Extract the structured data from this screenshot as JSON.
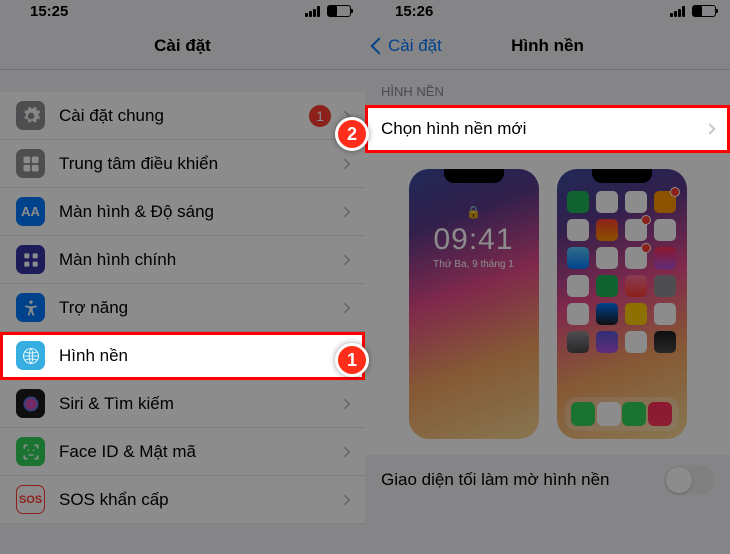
{
  "markers": {
    "one": "1",
    "two": "2"
  },
  "left": {
    "status": {
      "time": "15:25"
    },
    "title": "Cài đặt",
    "rows": {
      "general": {
        "label": "Cài đặt chung",
        "badge": "1"
      },
      "control": {
        "label": "Trung tâm điều khiển"
      },
      "display": {
        "label": "Màn hình & Độ sáng",
        "icon": "AA"
      },
      "home": {
        "label": "Màn hình chính"
      },
      "access": {
        "label": "Trợ năng"
      },
      "wallpaper": {
        "label": "Hình nền"
      },
      "siri": {
        "label": "Siri & Tìm kiếm"
      },
      "faceid": {
        "label": "Face ID & Mật mã"
      },
      "sos": {
        "label": "SOS khẩn cấp",
        "icon": "SOS"
      }
    }
  },
  "right": {
    "status": {
      "time": "15:26"
    },
    "back": "Cài đặt",
    "title": "Hình nền",
    "section": "HÌNH NỀN",
    "choose": "Chọn hình nền mới",
    "lock": {
      "time": "09:41",
      "date": "Thứ Ba, 9 tháng 1",
      "lock": "🔒"
    },
    "dark_toggle": "Giao diện tối làm mờ hình nền"
  }
}
